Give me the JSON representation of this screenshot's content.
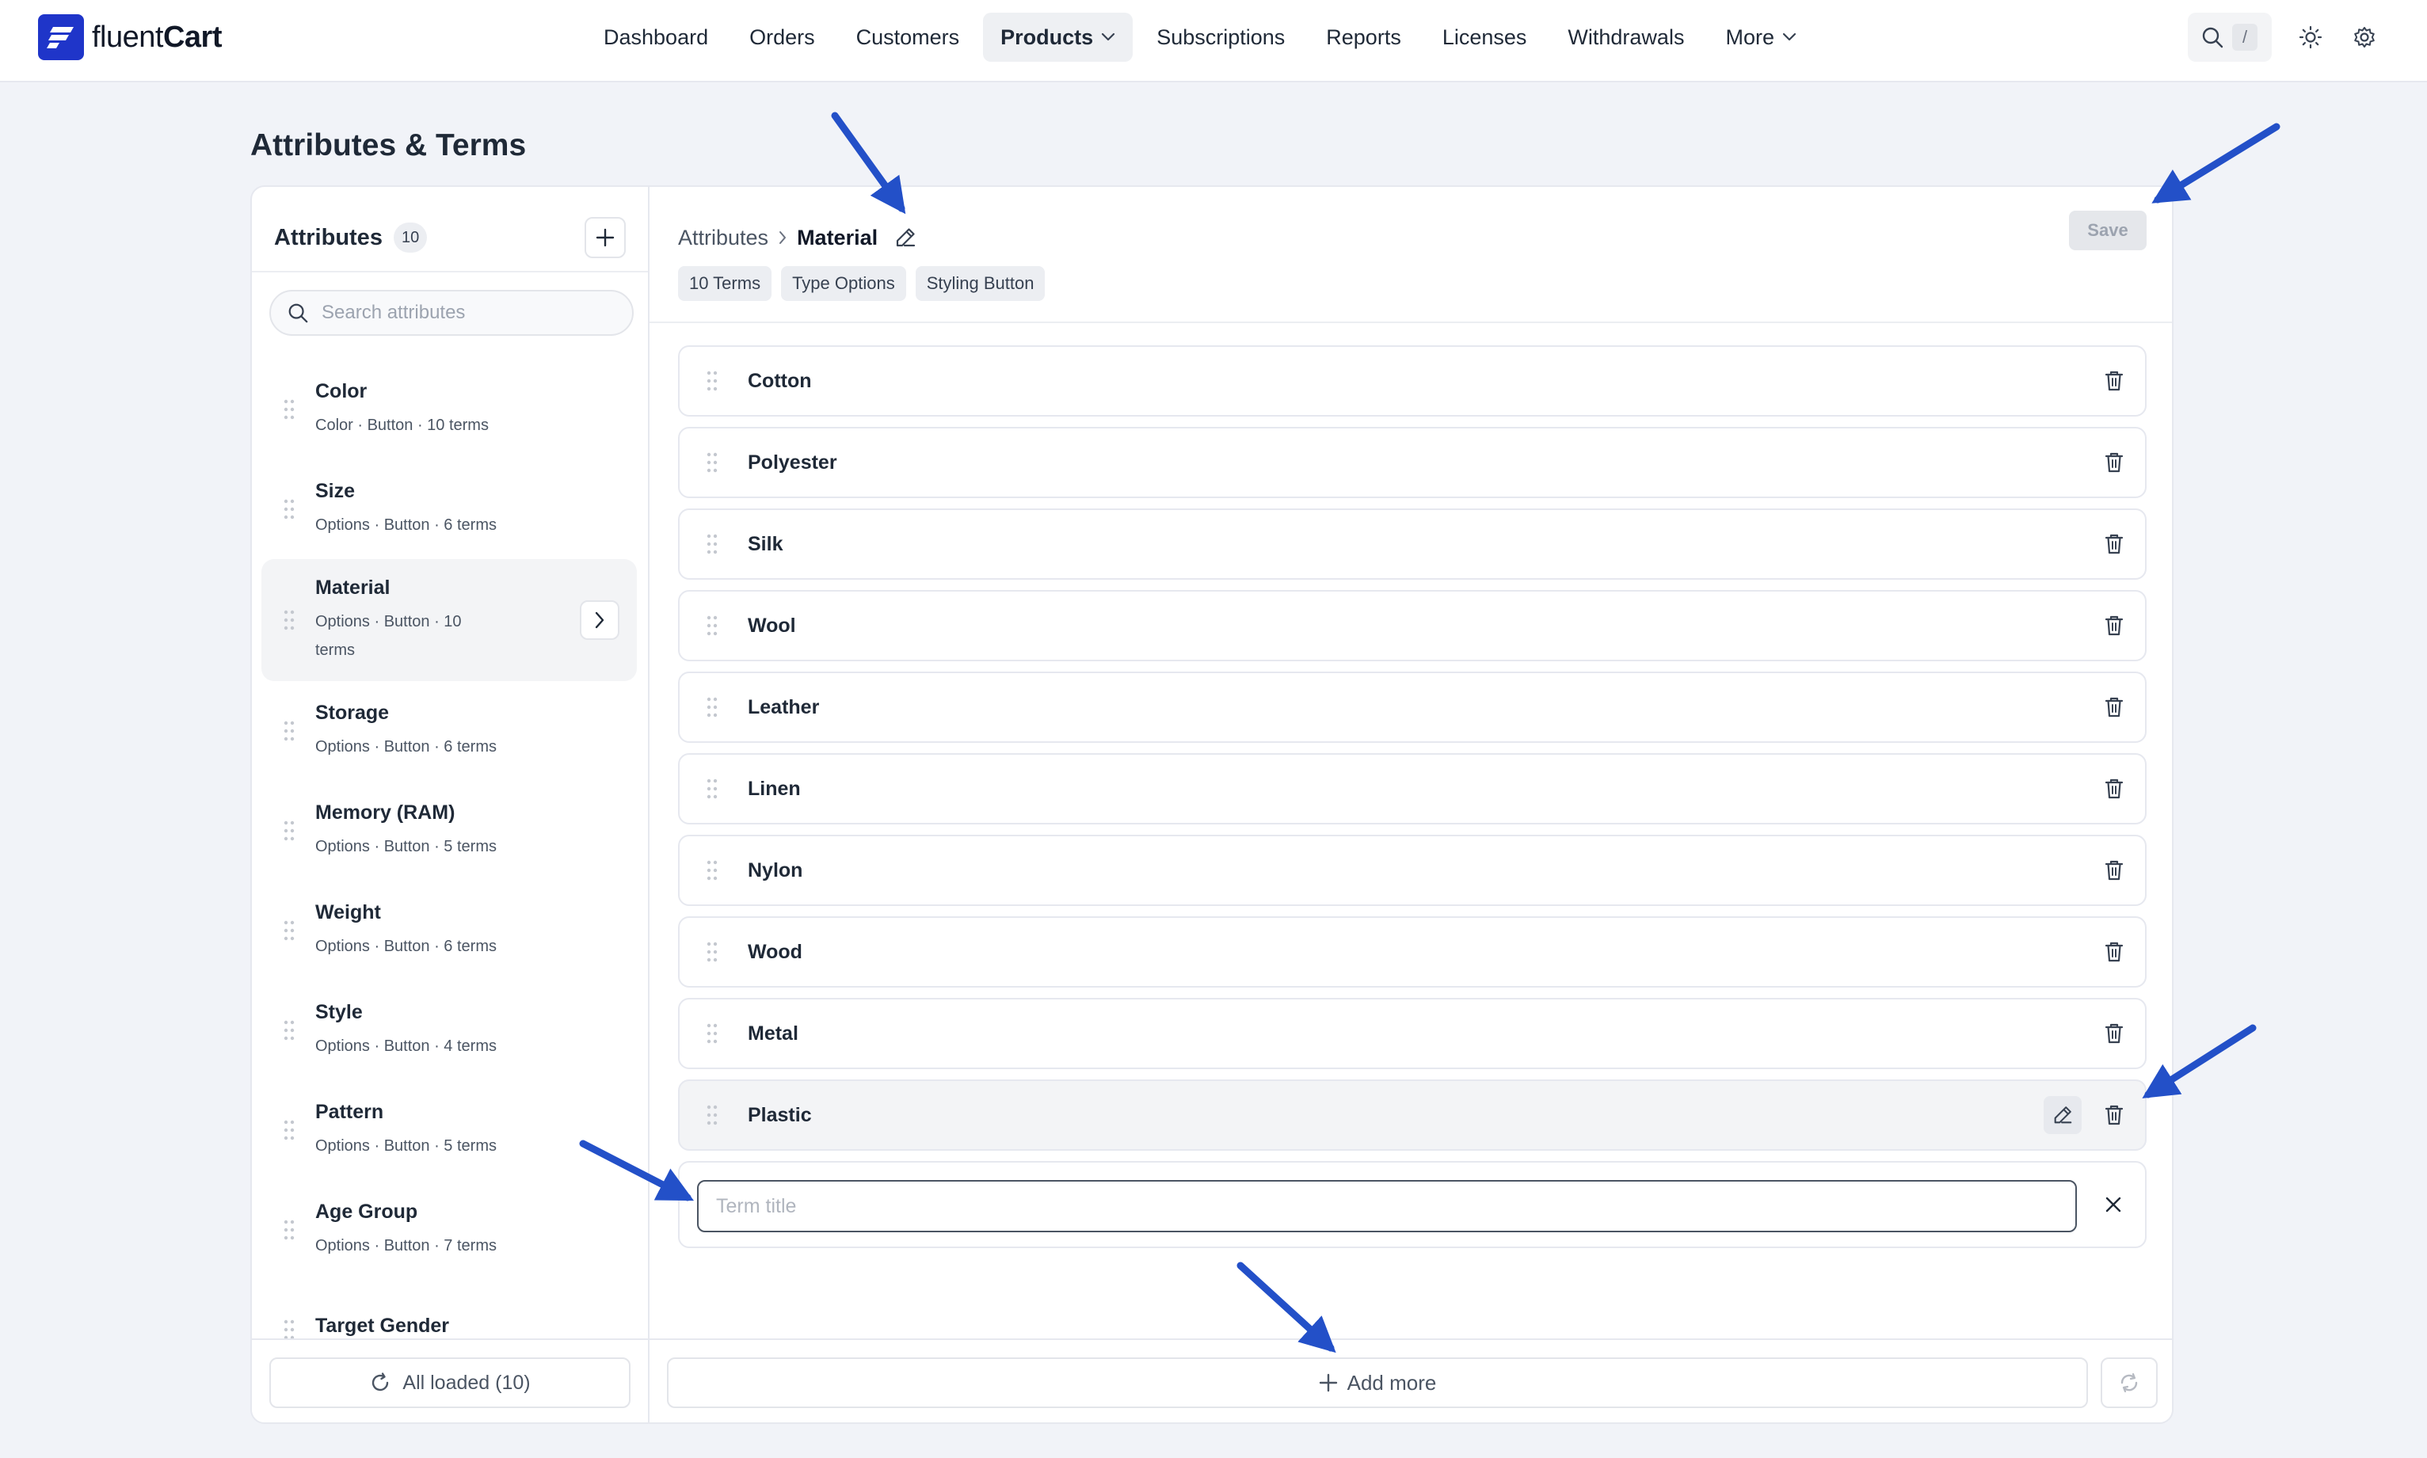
{
  "app": {
    "logo_text_light": "fluent",
    "logo_text_bold": "Cart"
  },
  "nav": {
    "items": [
      {
        "label": "Dashboard"
      },
      {
        "label": "Orders"
      },
      {
        "label": "Customers"
      },
      {
        "label": "Products",
        "active": true,
        "dropdown": true
      },
      {
        "label": "Subscriptions"
      },
      {
        "label": "Reports"
      },
      {
        "label": "Licenses"
      },
      {
        "label": "Withdrawals"
      },
      {
        "label": "More",
        "dropdown": true
      }
    ],
    "search_shortcut": "/",
    "icons": [
      "search-icon",
      "sun-icon",
      "gear-icon"
    ]
  },
  "page": {
    "title": "Attributes & Terms"
  },
  "sidebar": {
    "title": "Attributes",
    "count": "10",
    "search_placeholder": "Search attributes",
    "items": [
      {
        "name": "Color",
        "meta": "Color · Button · 10 terms"
      },
      {
        "name": "Size",
        "meta": "Options · Button · 6 terms"
      },
      {
        "name": "Material",
        "meta_line1": "Options · Button · 10",
        "meta_line2": "terms",
        "active": true
      },
      {
        "name": "Storage",
        "meta": "Options · Button · 6 terms"
      },
      {
        "name": "Memory (RAM)",
        "meta": "Options · Button · 5 terms"
      },
      {
        "name": "Weight",
        "meta": "Options · Button · 6 terms"
      },
      {
        "name": "Style",
        "meta": "Options · Button · 4 terms"
      },
      {
        "name": "Pattern",
        "meta": "Options · Button · 5 terms"
      },
      {
        "name": "Age Group",
        "meta": "Options · Button · 7 terms"
      },
      {
        "name": "Target Gender",
        "meta": ""
      }
    ],
    "footer_label": "All loaded (10)"
  },
  "detail": {
    "breadcrumb_root": "Attributes",
    "breadcrumb_current": "Material",
    "save_label": "Save",
    "chips": [
      "10 Terms",
      "Type Options",
      "Styling Button"
    ],
    "terms": [
      "Cotton",
      "Polyester",
      "Silk",
      "Wool",
      "Leather",
      "Linen",
      "Nylon",
      "Wood",
      "Metal",
      "Plastic"
    ],
    "hovered_term": "Plastic",
    "new_term_placeholder": "Term title",
    "new_term_value": "",
    "add_more_label": "Add more"
  },
  "colors": {
    "brand": "#1f35c9",
    "annotation_arrow": "#2350c8",
    "page_bg": "#f1f3f8"
  }
}
